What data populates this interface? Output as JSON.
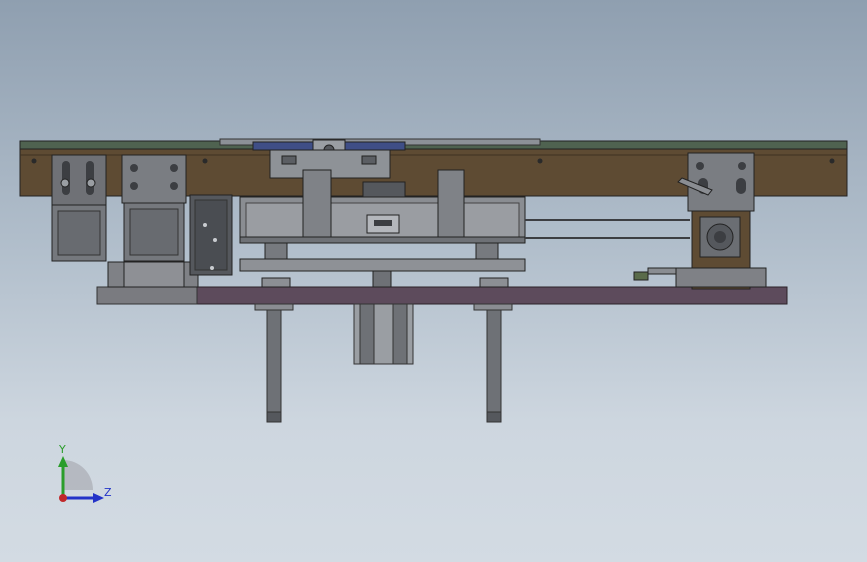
{
  "view": {
    "background_top": "#8f9fb0",
    "background_bottom": "#d3dbe3"
  },
  "model": {
    "colors": {
      "frame_brown": "#5e4b33",
      "frame_top_green": "#4f6250",
      "base_plate_purple": "#5d4b5c",
      "steel_gray": "#8f9398",
      "dark_steel": "#55585d",
      "motor_gray": "#75787d",
      "blue_part": "#3f4e86"
    }
  },
  "triad": {
    "y_label": "Y",
    "z_label": "Z",
    "y_color": "#2a9d2a",
    "z_color": "#2333c8",
    "origin_color": "#c0282a"
  }
}
